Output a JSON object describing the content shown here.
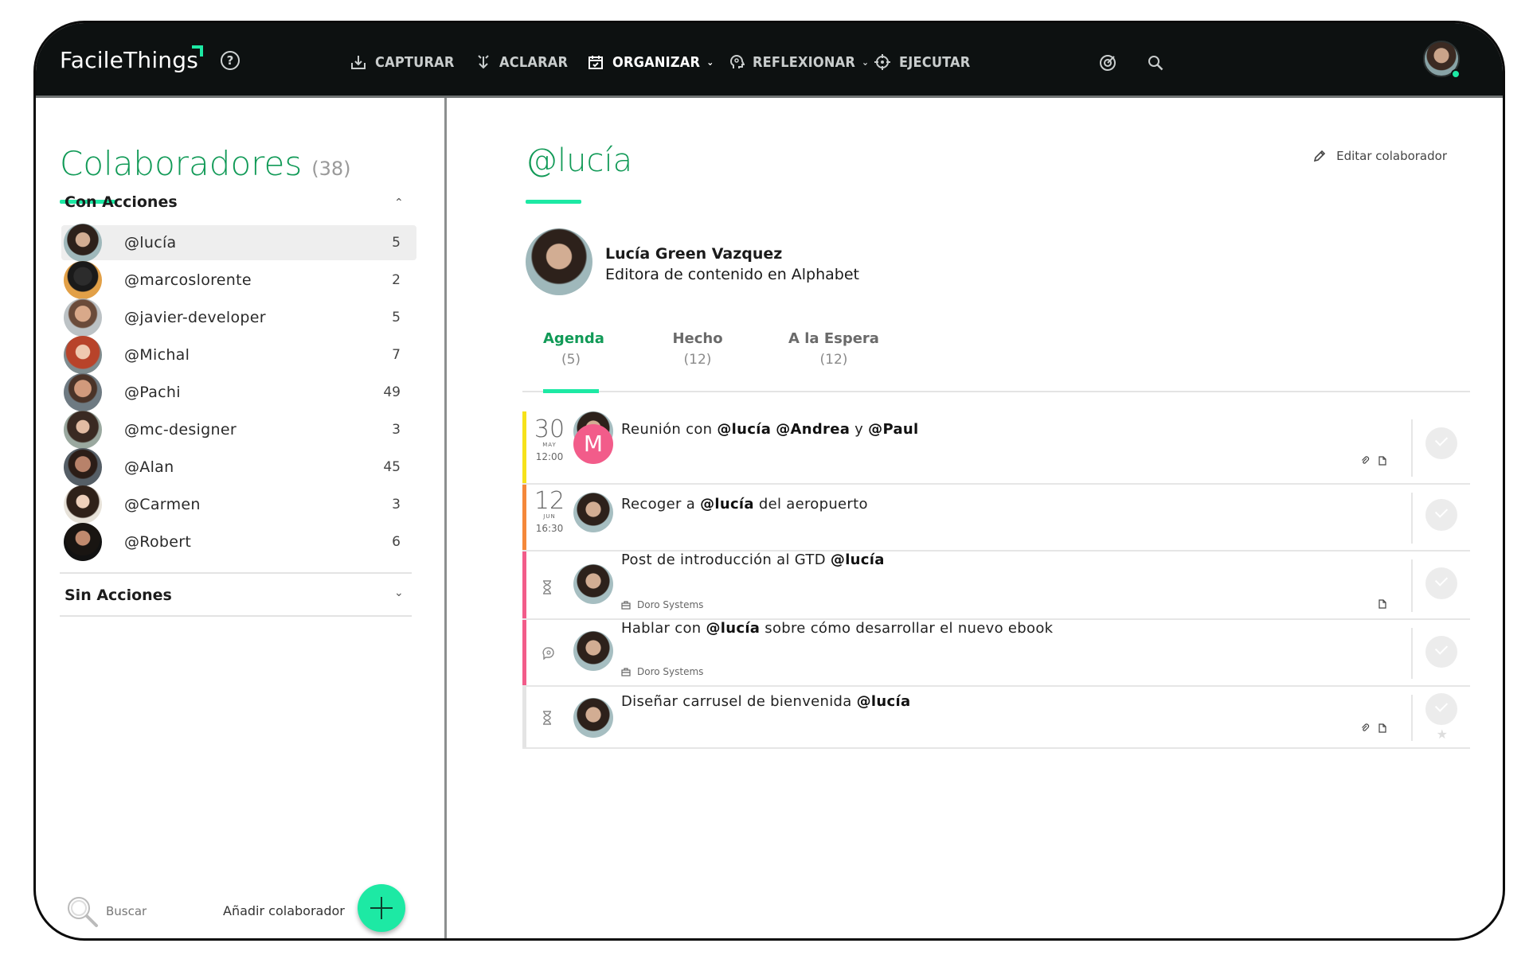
{
  "app": {
    "brand": "FacileThings",
    "help": "?"
  },
  "nav": {
    "capturar": "CAPTURAR",
    "aclarar": "ACLARAR",
    "organizar": "ORGANIZAR",
    "reflexionar": "REFLEXIONAR",
    "ejecutar": "EJECUTAR",
    "active": "ORGANIZAR"
  },
  "sidebar": {
    "title": "Colaboradores",
    "count": "(38)",
    "section_with": "Con Acciones",
    "section_without": "Sin Acciones",
    "collaborators": [
      {
        "name": "@lucía",
        "count": "5",
        "selected": true
      },
      {
        "name": "@marcoslorente",
        "count": "2"
      },
      {
        "name": "@javier-developer",
        "count": "5"
      },
      {
        "name": "@Michal",
        "count": "7"
      },
      {
        "name": "@Pachi",
        "count": "49"
      },
      {
        "name": "@mc-designer",
        "count": "3"
      },
      {
        "name": "@Alan",
        "count": "45"
      },
      {
        "name": "@Carmen",
        "count": "3"
      },
      {
        "name": "@Robert",
        "count": "6"
      }
    ],
    "search": "Buscar",
    "add": "Añadir colaborador"
  },
  "main": {
    "title": "@lucía",
    "edit": "Editar colaborador",
    "profile": {
      "name": "Lucía Green Vazquez",
      "role": "Editora de contenido en Alphabet"
    },
    "tabs": [
      {
        "label": "Agenda",
        "count": "(5)",
        "active": true
      },
      {
        "label": "Hecho",
        "count": "(12)"
      },
      {
        "label": "A la Espera",
        "count": "(12)"
      }
    ],
    "tasks": [
      {
        "bar_color": "#f6e21a",
        "date": {
          "day": "30",
          "month": "MAY",
          "time": "12:00"
        },
        "badge": "M",
        "parts": [
          {
            "t": "Reunión con ",
            "b": false
          },
          {
            "t": "@lucía",
            "b": true
          },
          {
            "t": " ",
            "b": false
          },
          {
            "t": "@Andrea",
            "b": true
          },
          {
            "t": " y ",
            "b": false
          },
          {
            "t": "@Paul",
            "b": true
          }
        ],
        "icons": [
          "paperclip-icon",
          "note-icon"
        ]
      },
      {
        "bar_color": "#f5883a",
        "date": {
          "day": "12",
          "month": "JUN",
          "time": "16:30"
        },
        "parts": [
          {
            "t": "Recoger a ",
            "b": false
          },
          {
            "t": "@lucía",
            "b": true
          },
          {
            "t": " del aeropuerto",
            "b": false
          }
        ],
        "icons": []
      },
      {
        "bar_color": "#f25c8a",
        "state_icon": "hourglass-icon",
        "parts": [
          {
            "t": "Post de introducción al GTD ",
            "b": false
          },
          {
            "t": "@lucía",
            "b": true
          }
        ],
        "project": "Doro Systems",
        "icons": [
          "note-icon"
        ]
      },
      {
        "bar_color": "#f25c8a",
        "state_icon": "talk-icon",
        "parts": [
          {
            "t": "Hablar con ",
            "b": false
          },
          {
            "t": "@lucía",
            "b": true
          },
          {
            "t": " sobre cómo desarrollar el nuevo ebook",
            "b": false
          }
        ],
        "project": "Doro Systems",
        "icons": []
      },
      {
        "bar_color": "#e4e4e4",
        "state_icon": "hourglass-icon",
        "parts": [
          {
            "t": "Diseñar carrusel de bienvenida ",
            "b": false
          },
          {
            "t": "@lucía",
            "b": true
          }
        ],
        "icons": [
          "paperclip-icon",
          "note-icon"
        ],
        "starred": true
      }
    ]
  },
  "colors": {
    "accent": "#1de9a4",
    "title_green": "#119a57",
    "topbar": "#0d1111"
  }
}
